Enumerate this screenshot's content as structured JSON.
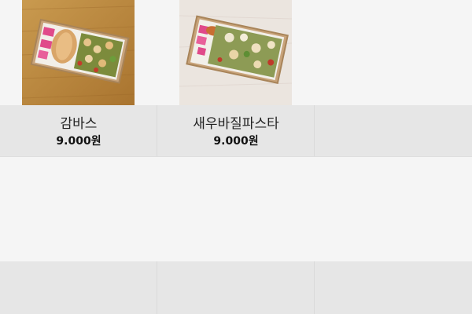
{
  "menu": {
    "items": [
      {
        "name": "감바스",
        "price": "9.000원"
      },
      {
        "name": "새우바질파스타",
        "price": "9.000원"
      }
    ]
  },
  "colors": {
    "label_row_bg": "#e6e6e6",
    "page_bg": "#f5f5f5"
  }
}
